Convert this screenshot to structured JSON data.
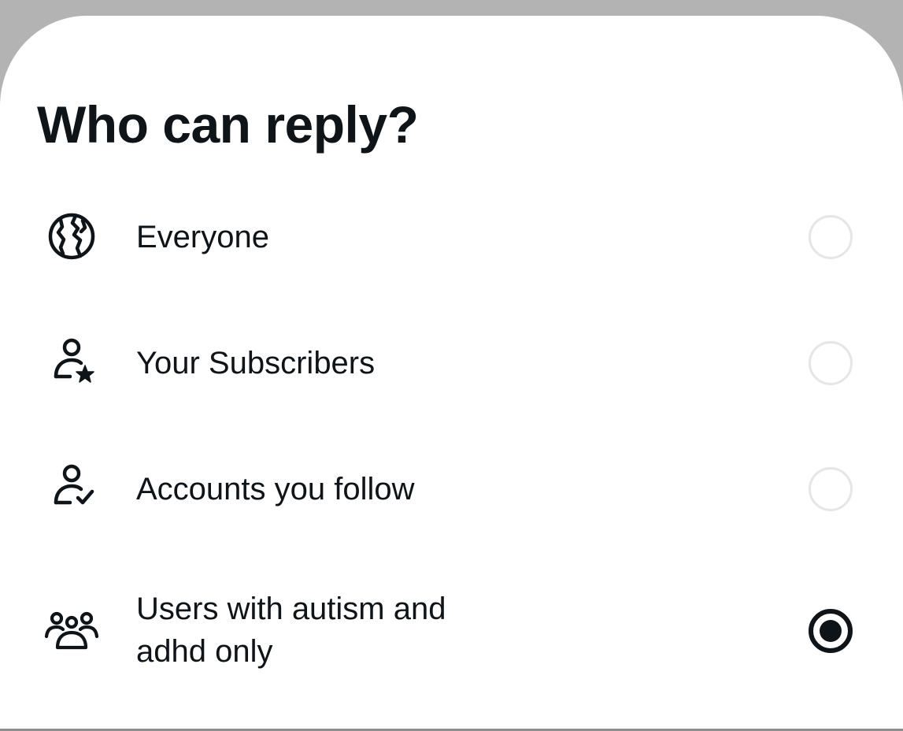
{
  "sheet": {
    "title": "Who can reply?"
  },
  "options": [
    {
      "label": "Everyone",
      "icon": "globe-icon",
      "selected": false
    },
    {
      "label": "Your Subscribers",
      "icon": "person-star-icon",
      "selected": false
    },
    {
      "label": "Accounts you follow",
      "icon": "person-check-icon",
      "selected": false
    },
    {
      "label": "Users with autism and\nadhd only",
      "icon": "group-icon",
      "selected": true
    }
  ],
  "colors": {
    "text": "#0f1419",
    "radio_unselected_border": "#e4e6e8",
    "backdrop": "#b3b3b3"
  }
}
